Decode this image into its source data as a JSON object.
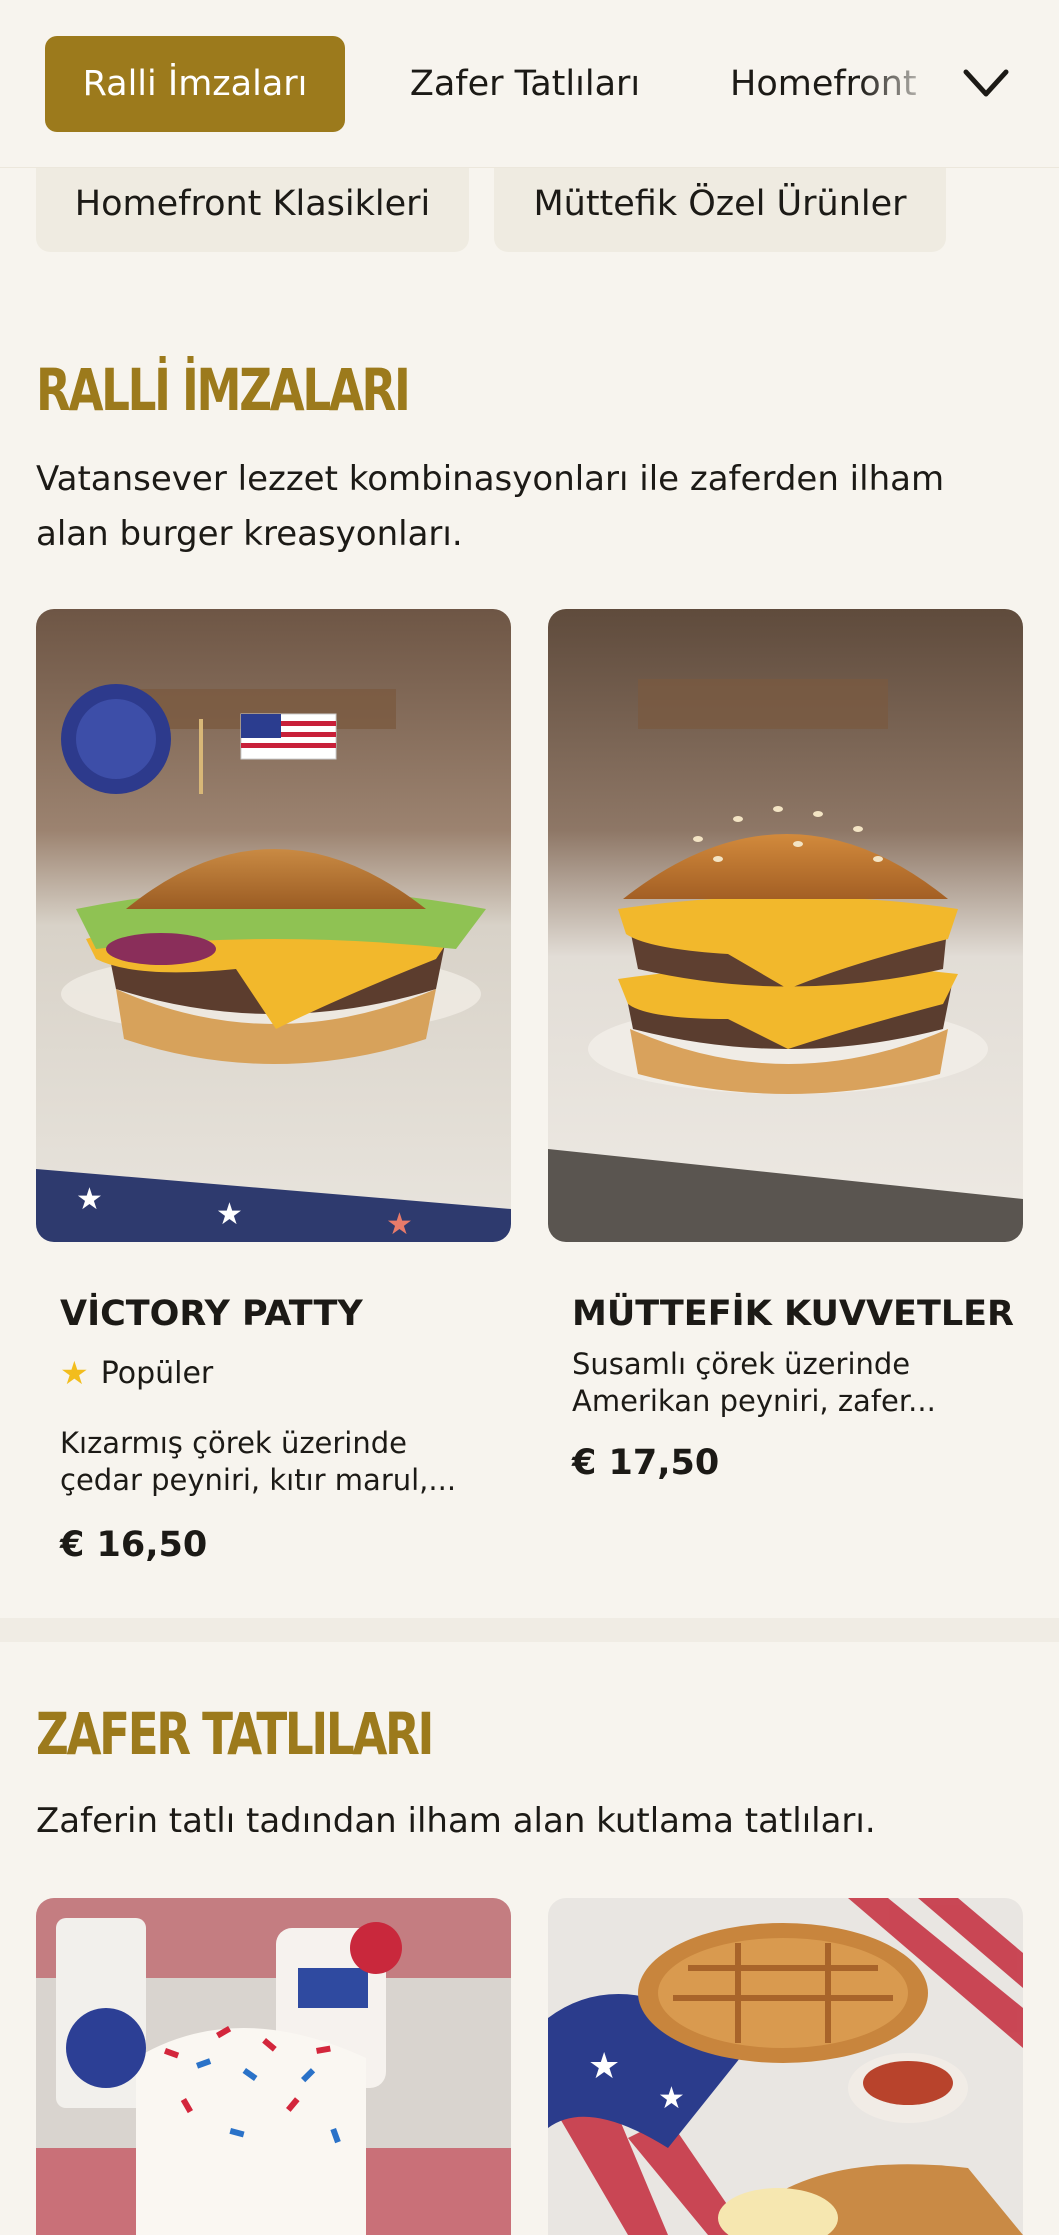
{
  "tabs": [
    {
      "label": "Ralli İmzaları",
      "active": true
    },
    {
      "label": "Zafer Tatlıları",
      "active": false
    },
    {
      "label": "Homefront",
      "active": false
    }
  ],
  "dropdown_pills": [
    {
      "label": "Homefront Klasikleri"
    },
    {
      "label": "Müttefik Özel Ürünler"
    }
  ],
  "sections": [
    {
      "title": "RALLİ İMZALARI",
      "description": "Vatansever lezzet kombinasyonları ile zaferden ilham alan burger kreasyonları.",
      "items": [
        {
          "name": "VİCTORY PATTY",
          "badge": "Popüler",
          "description": "Kızarmış çörek üzerinde çedar peyniri, kıtır marul,...",
          "price": "€ 16,50"
        },
        {
          "name": "MÜTTEFİK KUVVETLER",
          "description": "Susamlı çörek üzerinde Amerikan peyniri, zafer...",
          "price": "€ 17,50"
        }
      ]
    },
    {
      "title": "ZAFER TATLILARI",
      "description": "Zaferin tatlı tadından ilham alan kutlama tatlıları.",
      "items": []
    }
  ],
  "colors": {
    "accent": "#9c7a1c",
    "background": "#f7f4ee",
    "star": "#f2bd1d"
  },
  "icons": {
    "dropdown": "chevron-down-icon",
    "badge": "star-icon"
  }
}
